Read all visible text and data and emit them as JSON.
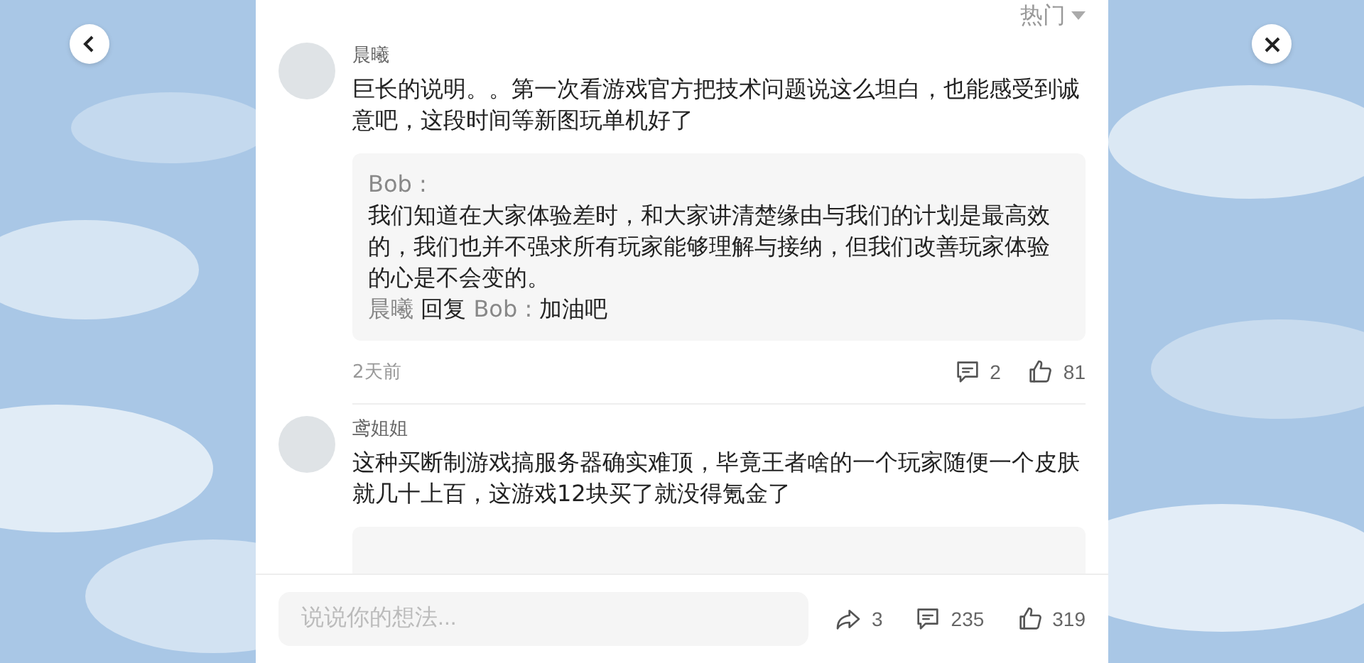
{
  "sort": {
    "label": "热门"
  },
  "comments": [
    {
      "author": "晨曦",
      "text": "巨长的说明。。第一次看游戏官方把技术问题说这么坦白，也能感受到诚意吧，这段时间等新图玩单机好了",
      "reply": {
        "from_label": "Bob :",
        "text": "我们知道在大家体验差时，和大家讲清楚缘由与我们的计划是最高效的，我们也并不强求所有玩家能够理解与接纳，但我们改善玩家体验的心是不会变的。",
        "sub": {
          "from": "晨曦",
          "verb": "回复",
          "to": "Bob :",
          "text": "加油吧"
        }
      },
      "time": "2天前",
      "replies": "2",
      "likes": "81"
    },
    {
      "author": "鸢姐姐",
      "text": "这种买断制游戏搞服务器确实难顶，毕竟王者啥的一个玩家随便一个皮肤就几十上百，这游戏12块买了就没得氪金了",
      "reply_box_cut": true
    }
  ],
  "bottom_bar": {
    "placeholder": "说说你的想法...",
    "shares": "3",
    "comments": "235",
    "likes": "319"
  }
}
